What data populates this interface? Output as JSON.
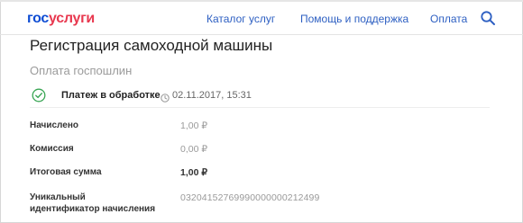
{
  "header": {
    "logo_part1": "гос",
    "logo_part2": "услуги",
    "nav": {
      "catalog": "Каталог услуг",
      "help": "Помощь и поддержка",
      "payment": "Оплата"
    },
    "search_icon": "search-icon"
  },
  "page": {
    "title": "Регистрация самоходной машины",
    "subtitle": "Оплата госпошлин"
  },
  "status": {
    "icon": "check-circle-icon",
    "text": "Платеж в обработке",
    "clock_icon": "clock-icon",
    "datetime": "02.11.2017, 15:31"
  },
  "details": {
    "charged_label": "Начислено",
    "charged_value": "1,00 ₽",
    "fee_label": "Комиссия",
    "fee_value": "0,00 ₽",
    "total_label": "Итоговая сумма",
    "total_value": "1,00 ₽",
    "uid_label_line1": "Уникальный",
    "uid_label_line2": "идентификатор начисления",
    "uid_value": "03204152769990000000212499"
  },
  "colors": {
    "brand_blue": "#0d4cd3",
    "brand_red": "#e8384f",
    "link_blue": "#2d5fc2",
    "success_green": "#3aa655"
  }
}
